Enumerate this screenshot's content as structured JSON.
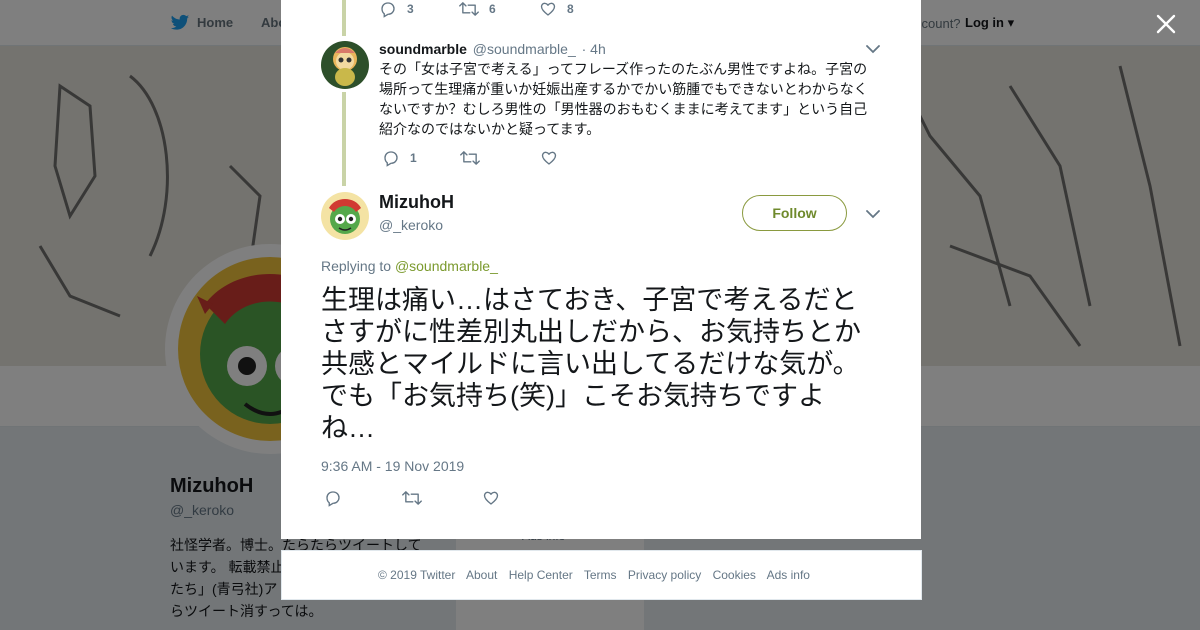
{
  "topnav": {
    "home_label": "Home",
    "about_label": "Abo",
    "have_account": "ccount?",
    "login_label": "Log in"
  },
  "profile": {
    "name": "MizuhoH",
    "handle": "@_keroko",
    "bio_lines": [
      "社怪学者。博士。たらたらツイートして",
      "います。 転載禁止",
      "たち」(青弓社)ア",
      "らツイート消すっては。"
    ],
    "extra": "",
    "mid_card_text": "Ads info"
  },
  "reply_tweet": {
    "author_name": "soundmarble",
    "author_handle": "@soundmarble_",
    "time": "· 4h",
    "text_lines": [
      "その「女は子宮で考える」ってフレーズ作ったのたぶん男性ですよね。子宮の",
      "場所って生理痛が重いか妊娠出産するかでかい筋腫でもできないとわからなく",
      "ないですか？むしろ男性の「男性器のおもむくままに考えてます」という自己",
      "紹介なのではないかと疑ってます。"
    ],
    "reply_count": "1",
    "retweet_count": "",
    "like_count": ""
  },
  "prev_tweet": {
    "reply_count": "3",
    "retweet_count": "6",
    "like_count": "8"
  },
  "main_tweet": {
    "author_name": "MizuhoH",
    "author_handle": "@_keroko",
    "follow_label": "Follow",
    "replying_to_prefix": "Replying to ",
    "replying_to_handle": "@soundmarble_",
    "text_lines": [
      "生理は痛い…はさておき、子宮で考えるだと",
      "さすがに性差別丸出しだから、お気持ちとか",
      "共感とマイルドに言い出してるだけな気が。",
      "でも「お気持ち(笑)」こそお気持ちですよ",
      "ね…"
    ],
    "timestamp": "9:36 AM - 19 Nov 2019"
  },
  "footer": {
    "copyright": "© 2019 Twitter",
    "about": "About",
    "help": "Help Center",
    "terms": "Terms",
    "privacy": "Privacy policy",
    "cookies": "Cookies",
    "ads": "Ads info"
  },
  "colors": {
    "accent": "#7b9a2e",
    "thread_line": "#c9d3a7",
    "muted": "#657786"
  },
  "icons": [
    "twitter-bird-icon",
    "close-icon",
    "reply-icon",
    "retweet-icon",
    "like-icon",
    "chevron-down-icon"
  ]
}
